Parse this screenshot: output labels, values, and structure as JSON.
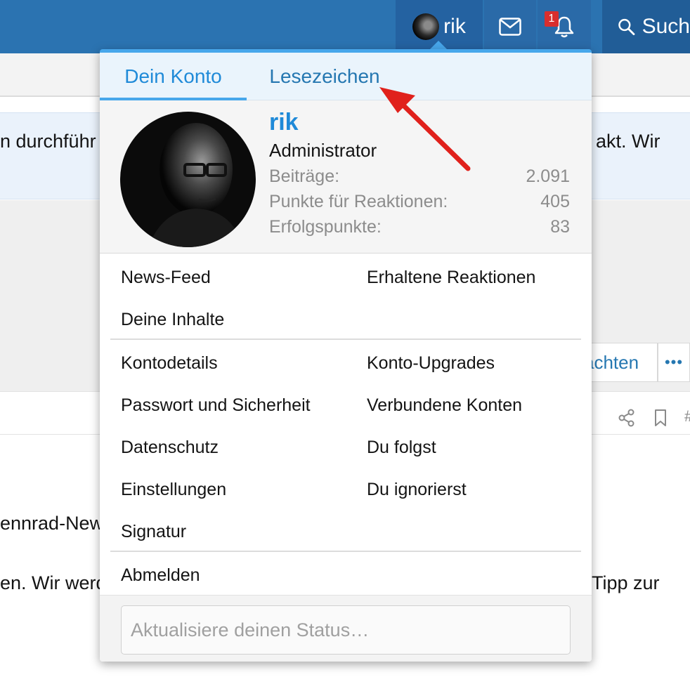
{
  "header": {
    "username": "rik",
    "notification_count": "1",
    "search_label": "Such"
  },
  "background": {
    "notice_left": "n durchführ",
    "notice_right": "akt. Wir",
    "watch_button": "achten",
    "more_button": "•••",
    "body_line1": "ennrad-New",
    "body_line2_left": "en. Wir werd",
    "body_line2_right": "Tipp zur",
    "hash_partial": "#"
  },
  "dropdown": {
    "tabs": [
      "Dein Konto",
      "Lesezeichen"
    ],
    "profile": {
      "name": "rik",
      "role": "Administrator",
      "stats": [
        {
          "label": "Beiträge:",
          "value": "2.091"
        },
        {
          "label": "Punkte für Reaktionen:",
          "value": "405"
        },
        {
          "label": "Erfolgspunkte:",
          "value": "83"
        }
      ]
    },
    "links": {
      "news_feed": "News-Feed",
      "reactions_received": "Erhaltene Reaktionen",
      "your_content": "Deine Inhalte",
      "account_details": "Kontodetails",
      "account_upgrades": "Konto-Upgrades",
      "password_security": "Passwort und Sicherheit",
      "connected_accounts": "Verbundene Konten",
      "privacy": "Datenschutz",
      "following": "Du folgst",
      "preferences": "Einstellungen",
      "ignoring": "Du ignorierst",
      "signature": "Signatur",
      "logout": "Abmelden"
    },
    "status_placeholder": "Aktualisiere deinen Status…"
  },
  "colors": {
    "header_blue": "#2b73b1",
    "accent_blue": "#47a7eb",
    "link_blue": "#2577b1",
    "badge_red": "#d82e2e",
    "arrow_red": "#e0211c"
  }
}
